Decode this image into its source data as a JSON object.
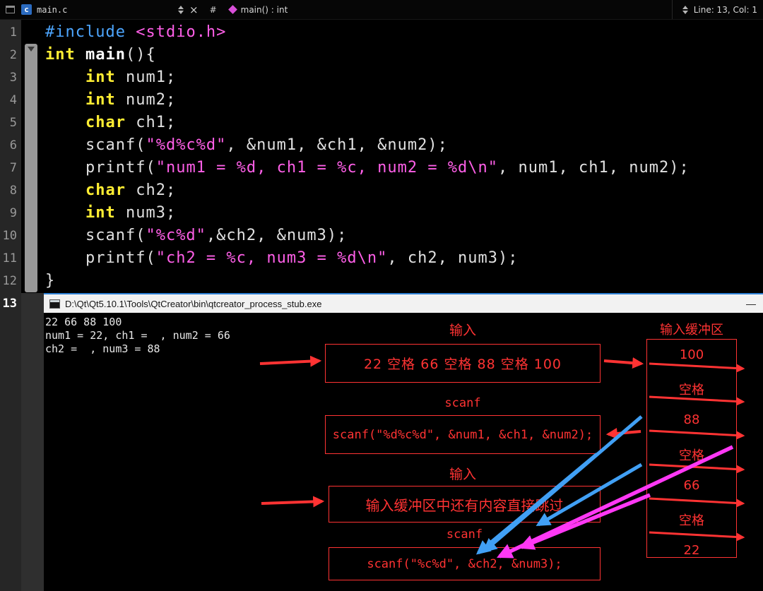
{
  "colors": {
    "annotation": "#ff3333",
    "blue_arrow": "#41a0f5",
    "magenta_arrow": "#ff38f5",
    "keyword": "#ffee33",
    "preprocessor": "#4da6ff",
    "string": "#ff5fe8",
    "accent_border": "#2d7fd4"
  },
  "topbar": {
    "file_icon": "c",
    "file_name": "main.c",
    "close_label": "×",
    "hash_label": "#",
    "function_selector": "main() : int",
    "cursor_position": "Line: 13, Col: 1"
  },
  "editor": {
    "current_line": 13,
    "lines": [
      {
        "no": 1,
        "segments": [
          {
            "t": "#include ",
            "c": "pp"
          },
          {
            "t": "<stdio.h>",
            "c": "str"
          }
        ]
      },
      {
        "no": 2,
        "segments": [
          {
            "t": "int",
            "c": "kw"
          },
          {
            "t": " ",
            "c": "pl"
          },
          {
            "t": "main",
            "c": "fn"
          },
          {
            "t": "(){",
            "c": "pl"
          }
        ]
      },
      {
        "no": 3,
        "segments": [
          {
            "t": "    ",
            "c": "pl"
          },
          {
            "t": "int",
            "c": "kw"
          },
          {
            "t": " num1;",
            "c": "pl"
          }
        ]
      },
      {
        "no": 4,
        "segments": [
          {
            "t": "    ",
            "c": "pl"
          },
          {
            "t": "int",
            "c": "kw"
          },
          {
            "t": " num2;",
            "c": "pl"
          }
        ]
      },
      {
        "no": 5,
        "segments": [
          {
            "t": "    ",
            "c": "pl"
          },
          {
            "t": "char",
            "c": "kw"
          },
          {
            "t": " ch1;",
            "c": "pl"
          }
        ]
      },
      {
        "no": 6,
        "segments": [
          {
            "t": "    scanf(",
            "c": "pl"
          },
          {
            "t": "\"%d%c%d\"",
            "c": "str"
          },
          {
            "t": ", &num1, &ch1, &num2);",
            "c": "pl"
          }
        ]
      },
      {
        "no": 7,
        "segments": [
          {
            "t": "    printf(",
            "c": "pl"
          },
          {
            "t": "\"num1 = %d, ch1 = %c, num2 = %d\\n\"",
            "c": "str"
          },
          {
            "t": ", num1, ch1, num2);",
            "c": "pl"
          }
        ]
      },
      {
        "no": 8,
        "segments": [
          {
            "t": "    ",
            "c": "pl"
          },
          {
            "t": "char",
            "c": "kw"
          },
          {
            "t": " ch2;",
            "c": "pl"
          }
        ]
      },
      {
        "no": 9,
        "segments": [
          {
            "t": "    ",
            "c": "pl"
          },
          {
            "t": "int",
            "c": "kw"
          },
          {
            "t": " num3;",
            "c": "pl"
          }
        ]
      },
      {
        "no": 10,
        "segments": [
          {
            "t": "    scanf(",
            "c": "pl"
          },
          {
            "t": "\"%c%d\"",
            "c": "str"
          },
          {
            "t": ",&ch2, &num3);",
            "c": "pl"
          }
        ]
      },
      {
        "no": 11,
        "segments": [
          {
            "t": "    printf(",
            "c": "pl"
          },
          {
            "t": "\"ch2 = %c, num3 = %d\\n\"",
            "c": "str"
          },
          {
            "t": ", ch2, num3);",
            "c": "pl"
          }
        ]
      },
      {
        "no": 12,
        "segments": [
          {
            "t": "}",
            "c": "pl"
          }
        ]
      },
      {
        "no": 13,
        "segments": []
      }
    ]
  },
  "console": {
    "title": "D:\\Qt\\Qt5.10.1\\Tools\\QtCreator\\bin\\qtcreator_process_stub.exe",
    "minimize_label": "—",
    "output": [
      "22 66 88 100",
      "num1 = 22, ch1 =  , num2 = 66",
      "ch2 =  , num3 = 88"
    ]
  },
  "diagram": {
    "input_label_1": "输入",
    "input_box": "22 空格 66 空格 88 空格 100",
    "buffer_label": "输入缓冲区",
    "buffer_items": [
      "100",
      "空格",
      "88",
      "空格",
      "66",
      "空格",
      "22"
    ],
    "scanf_label_1": "scanf",
    "scanf_box_1": "scanf(\"%d%c%d\", &num1, &ch1, &num2);",
    "input_label_2": "输入",
    "skip_box": "输入缓冲区中还有内容直接跳过",
    "scanf_label_2": "scanf",
    "scanf_box_2": "scanf(\"%c%d\", &ch2, &num3);"
  }
}
